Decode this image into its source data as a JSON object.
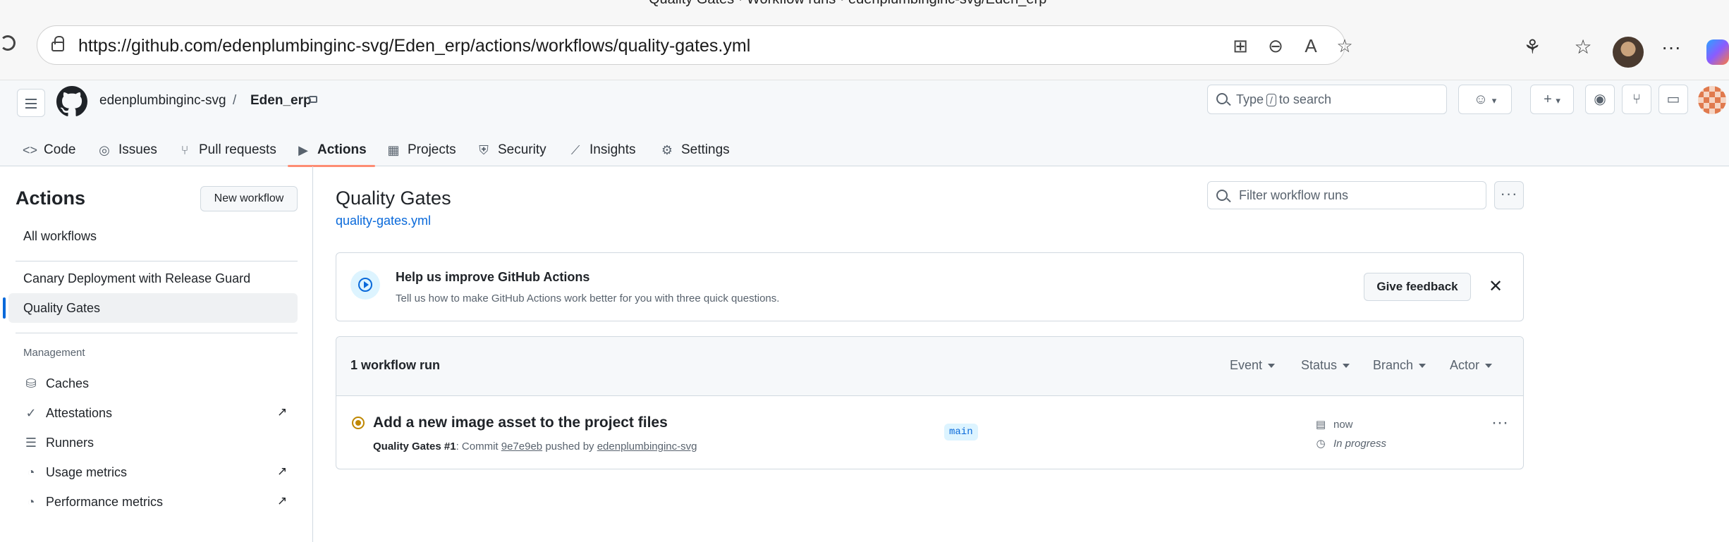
{
  "browser": {
    "window_title": "Quality Gates · Workflow runs · edenplumbinginc-svg/Eden_erp",
    "url": "https://github.com/edenplumbinginc-svg/Eden_erp/actions/workflows/quality-gates.yml"
  },
  "repo": {
    "owner": "edenplumbinginc-svg",
    "separator": "/",
    "name": "Eden_erp"
  },
  "header": {
    "search_prefix": "Type",
    "search_key": "/",
    "search_suffix": "to search",
    "plus": "+"
  },
  "tabs": [
    {
      "label": "Code",
      "icon": "<>"
    },
    {
      "label": "Issues",
      "icon": "◎"
    },
    {
      "label": "Pull requests",
      "icon": "⑂"
    },
    {
      "label": "Actions",
      "icon": "▶"
    },
    {
      "label": "Projects",
      "icon": "▦"
    },
    {
      "label": "Security",
      "icon": "⛨"
    },
    {
      "label": "Insights",
      "icon": "⟋"
    },
    {
      "label": "Settings",
      "icon": "⚙"
    }
  ],
  "sidebar": {
    "title": "Actions",
    "new_workflow": "New workflow",
    "all_workflows": "All workflows",
    "workflows": [
      "Canary Deployment with Release Guard",
      "Quality Gates"
    ],
    "management_heading": "Management",
    "management": [
      {
        "label": "Caches",
        "icon": "⛁"
      },
      {
        "label": "Attestations",
        "icon": "✓"
      },
      {
        "label": "Runners",
        "icon": "☰"
      },
      {
        "label": "Usage metrics",
        "icon": "◔"
      },
      {
        "label": "Performance metrics",
        "icon": "◔"
      }
    ],
    "external_arrow": "↗"
  },
  "main": {
    "title": "Quality Gates",
    "file_link": "quality-gates.yml",
    "filter_placeholder": "Filter workflow runs",
    "more": "···"
  },
  "banner": {
    "heading": "Help us improve GitHub Actions",
    "text": "Tell us how to make GitHub Actions work better for you with three quick questions.",
    "feedback_button": "Give feedback",
    "close": "✕"
  },
  "runs": {
    "count_label": "1 workflow run",
    "filters": [
      "Event",
      "Status",
      "Branch",
      "Actor"
    ],
    "items": [
      {
        "title": "Add a new image asset to the project files",
        "workflow": "Quality Gates",
        "run_number": "#1",
        "commit_prefix": ": Commit",
        "commit_sha": "9e7e9eb",
        "pushed_by_text": "pushed by",
        "actor": "edenplumbinginc-svg",
        "branch": "main",
        "time": "now",
        "duration": "In progress",
        "status": "in-progress",
        "status_color": "#bf8700"
      }
    ]
  },
  "colors": {
    "accent_blue": "#0969da",
    "active_tab_underline": "#fd8c73",
    "border": "#d1d9e0"
  }
}
